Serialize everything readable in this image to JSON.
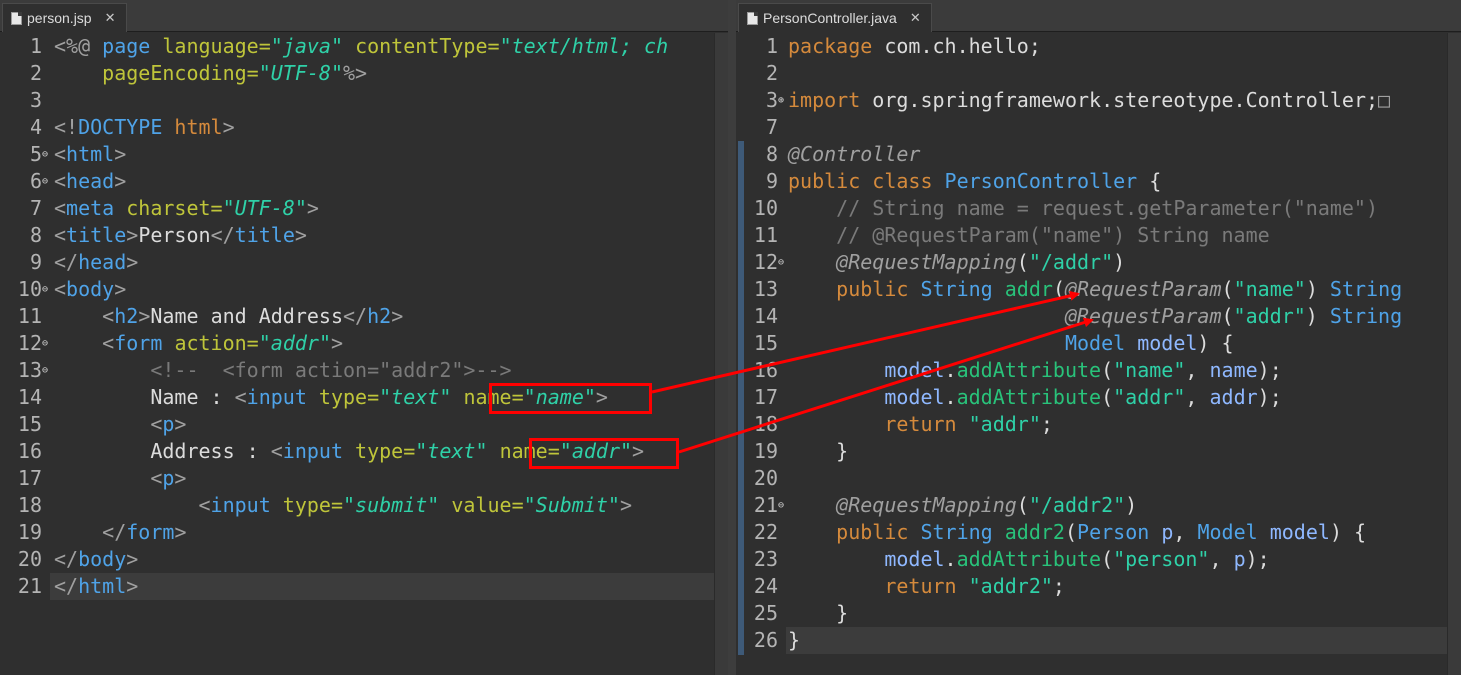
{
  "left_editor": {
    "tab_label": "person.jsp",
    "lines": [
      {
        "n": "1",
        "fold": "",
        "segs": [
          [
            "br",
            "<%@ "
          ],
          [
            "tg",
            "page "
          ],
          [
            "at",
            "language="
          ],
          [
            "av",
            "\"java\" "
          ],
          [
            "at",
            "contentType="
          ],
          [
            "av",
            "\"text/html; ch"
          ]
        ]
      },
      {
        "n": "2",
        "fold": "",
        "segs": [
          [
            "tx",
            "    "
          ],
          [
            "at",
            "pageEncoding="
          ],
          [
            "av",
            "\"UTF-8\""
          ],
          [
            "br",
            "%>"
          ]
        ]
      },
      {
        "n": "3",
        "fold": "",
        "segs": []
      },
      {
        "n": "4",
        "fold": "",
        "segs": [
          [
            "br",
            "<!"
          ],
          [
            "tg",
            "DOCTYPE "
          ],
          [
            "kw",
            "html"
          ],
          [
            "br",
            ">"
          ]
        ]
      },
      {
        "n": "5",
        "fold": "⊖",
        "segs": [
          [
            "br",
            "<"
          ],
          [
            "tg",
            "html"
          ],
          [
            "br",
            ">"
          ]
        ]
      },
      {
        "n": "6",
        "fold": "⊖",
        "segs": [
          [
            "br",
            "<"
          ],
          [
            "tg",
            "head"
          ],
          [
            "br",
            ">"
          ]
        ]
      },
      {
        "n": "7",
        "fold": "",
        "segs": [
          [
            "br",
            "<"
          ],
          [
            "tg",
            "meta "
          ],
          [
            "at",
            "charset="
          ],
          [
            "av",
            "\"UTF-8\""
          ],
          [
            "br",
            ">"
          ]
        ]
      },
      {
        "n": "8",
        "fold": "",
        "segs": [
          [
            "br",
            "<"
          ],
          [
            "tg",
            "title"
          ],
          [
            "br",
            ">"
          ],
          [
            "tx",
            "Person"
          ],
          [
            "br",
            "</"
          ],
          [
            "tg",
            "title"
          ],
          [
            "br",
            ">"
          ]
        ]
      },
      {
        "n": "9",
        "fold": "",
        "segs": [
          [
            "br",
            "</"
          ],
          [
            "tg",
            "head"
          ],
          [
            "br",
            ">"
          ]
        ]
      },
      {
        "n": "10",
        "fold": "⊖",
        "segs": [
          [
            "br",
            "<"
          ],
          [
            "tg",
            "body"
          ],
          [
            "br",
            ">"
          ]
        ]
      },
      {
        "n": "11",
        "fold": "",
        "segs": [
          [
            "tx",
            "    "
          ],
          [
            "br",
            "<"
          ],
          [
            "tg",
            "h2"
          ],
          [
            "br",
            ">"
          ],
          [
            "tx",
            "Name and Address"
          ],
          [
            "br",
            "</"
          ],
          [
            "tg",
            "h2"
          ],
          [
            "br",
            ">"
          ]
        ]
      },
      {
        "n": "12",
        "fold": "⊖",
        "segs": [
          [
            "tx",
            "    "
          ],
          [
            "br",
            "<"
          ],
          [
            "tg",
            "form "
          ],
          [
            "at",
            "action="
          ],
          [
            "av",
            "\"addr\""
          ],
          [
            "br",
            ">"
          ]
        ]
      },
      {
        "n": "13",
        "fold": "⊖",
        "segs": [
          [
            "tx",
            "        "
          ],
          [
            "cm",
            "<!--  <form action=\"addr2\">-->"
          ]
        ]
      },
      {
        "n": "14",
        "fold": "",
        "segs": [
          [
            "tx",
            "        Name : "
          ],
          [
            "br",
            "<"
          ],
          [
            "tg",
            "input "
          ],
          [
            "at",
            "type="
          ],
          [
            "av",
            "\"text\" "
          ],
          [
            "at",
            "name="
          ],
          [
            "av",
            "\"name\""
          ],
          [
            "br",
            ">"
          ]
        ]
      },
      {
        "n": "15",
        "fold": "",
        "segs": [
          [
            "tx",
            "        "
          ],
          [
            "br",
            "<"
          ],
          [
            "tg",
            "p"
          ],
          [
            "br",
            ">"
          ]
        ]
      },
      {
        "n": "16",
        "fold": "",
        "segs": [
          [
            "tx",
            "        Address : "
          ],
          [
            "br",
            "<"
          ],
          [
            "tg",
            "input "
          ],
          [
            "at",
            "type="
          ],
          [
            "av",
            "\"text\" "
          ],
          [
            "at",
            "name="
          ],
          [
            "av",
            "\"addr\""
          ],
          [
            "br",
            ">"
          ]
        ]
      },
      {
        "n": "17",
        "fold": "",
        "segs": [
          [
            "tx",
            "        "
          ],
          [
            "br",
            "<"
          ],
          [
            "tg",
            "p"
          ],
          [
            "br",
            ">"
          ]
        ]
      },
      {
        "n": "18",
        "fold": "",
        "segs": [
          [
            "tx",
            "            "
          ],
          [
            "br",
            "<"
          ],
          [
            "tg",
            "input "
          ],
          [
            "at",
            "type="
          ],
          [
            "av",
            "\"submit\" "
          ],
          [
            "at",
            "value="
          ],
          [
            "av",
            "\"Submit\""
          ],
          [
            "br",
            ">"
          ]
        ]
      },
      {
        "n": "19",
        "fold": "",
        "segs": [
          [
            "tx",
            "    "
          ],
          [
            "br",
            "</"
          ],
          [
            "tg",
            "form"
          ],
          [
            "br",
            ">"
          ]
        ]
      },
      {
        "n": "20",
        "fold": "",
        "segs": [
          [
            "br",
            "</"
          ],
          [
            "tg",
            "body"
          ],
          [
            "br",
            ">"
          ]
        ]
      },
      {
        "n": "21",
        "fold": "",
        "segs": [
          [
            "br",
            "</"
          ],
          [
            "tg",
            "html"
          ],
          [
            "br",
            ">"
          ]
        ]
      }
    ]
  },
  "right_editor": {
    "tab_label": "PersonController.java",
    "lines": [
      {
        "n": "1",
        "fold": "",
        "segs": [
          [
            "kw",
            "package "
          ],
          [
            "tx",
            "com.ch.hello;"
          ]
        ]
      },
      {
        "n": "2",
        "fold": "",
        "segs": []
      },
      {
        "n": "3",
        "fold": "⊕",
        "segs": [
          [
            "kw",
            "import "
          ],
          [
            "tx",
            "org.springframework.stereotype.Controller;"
          ],
          [
            "br",
            "□"
          ]
        ]
      },
      {
        "n": "7",
        "fold": "",
        "segs": []
      },
      {
        "n": "8",
        "fold": "",
        "segs": [
          [
            "an",
            "@Controller"
          ]
        ]
      },
      {
        "n": "9",
        "fold": "",
        "segs": [
          [
            "kw",
            "public class "
          ],
          [
            "ty",
            "PersonController "
          ],
          [
            "tx",
            "{"
          ]
        ]
      },
      {
        "n": "10",
        "fold": "",
        "segs": [
          [
            "tx",
            "    "
          ],
          [
            "cm",
            "// String name = request.getParameter(\"name\")"
          ]
        ]
      },
      {
        "n": "11",
        "fold": "",
        "segs": [
          [
            "tx",
            "    "
          ],
          [
            "cm",
            "// @RequestParam(\"name\") String name"
          ]
        ]
      },
      {
        "n": "12",
        "fold": "⊖",
        "segs": [
          [
            "tx",
            "    "
          ],
          [
            "an",
            "@RequestMapping"
          ],
          [
            "tx",
            "("
          ],
          [
            "st",
            "\"/addr\""
          ],
          [
            "tx",
            ")"
          ]
        ]
      },
      {
        "n": "13",
        "fold": "",
        "segs": [
          [
            "tx",
            "    "
          ],
          [
            "kw",
            "public "
          ],
          [
            "ty",
            "String "
          ],
          [
            "fn",
            "addr"
          ],
          [
            "tx",
            "("
          ],
          [
            "an",
            "@RequestParam"
          ],
          [
            "tx",
            "("
          ],
          [
            "st",
            "\"name\""
          ],
          [
            "tx",
            ") "
          ],
          [
            "ty",
            "String"
          ]
        ]
      },
      {
        "n": "14",
        "fold": "",
        "segs": [
          [
            "tx",
            "                       "
          ],
          [
            "an",
            "@RequestParam"
          ],
          [
            "tx",
            "("
          ],
          [
            "st",
            "\"addr\""
          ],
          [
            "tx",
            ") "
          ],
          [
            "ty",
            "String"
          ]
        ]
      },
      {
        "n": "15",
        "fold": "",
        "segs": [
          [
            "tx",
            "                       "
          ],
          [
            "ty",
            "Model "
          ],
          [
            "vr",
            "model"
          ],
          [
            "tx",
            ") {"
          ]
        ]
      },
      {
        "n": "16",
        "fold": "",
        "segs": [
          [
            "tx",
            "        "
          ],
          [
            "vr",
            "model"
          ],
          [
            "tx",
            "."
          ],
          [
            "fn",
            "addAttribute"
          ],
          [
            "tx",
            "("
          ],
          [
            "st",
            "\"name\""
          ],
          [
            "tx",
            ", "
          ],
          [
            "vr",
            "name"
          ],
          [
            "tx",
            ");"
          ]
        ]
      },
      {
        "n": "17",
        "fold": "",
        "segs": [
          [
            "tx",
            "        "
          ],
          [
            "vr",
            "model"
          ],
          [
            "tx",
            "."
          ],
          [
            "fn",
            "addAttribute"
          ],
          [
            "tx",
            "("
          ],
          [
            "st",
            "\"addr\""
          ],
          [
            "tx",
            ", "
          ],
          [
            "vr",
            "addr"
          ],
          [
            "tx",
            ");"
          ]
        ]
      },
      {
        "n": "18",
        "fold": "",
        "segs": [
          [
            "tx",
            "        "
          ],
          [
            "kw",
            "return "
          ],
          [
            "st",
            "\"addr\""
          ],
          [
            "tx",
            ";"
          ]
        ]
      },
      {
        "n": "19",
        "fold": "",
        "segs": [
          [
            "tx",
            "    }"
          ]
        ]
      },
      {
        "n": "20",
        "fold": "",
        "segs": []
      },
      {
        "n": "21",
        "fold": "⊖",
        "segs": [
          [
            "tx",
            "    "
          ],
          [
            "an",
            "@RequestMapping"
          ],
          [
            "tx",
            "("
          ],
          [
            "st",
            "\"/addr2\""
          ],
          [
            "tx",
            ")"
          ]
        ]
      },
      {
        "n": "22",
        "fold": "",
        "segs": [
          [
            "tx",
            "    "
          ],
          [
            "kw",
            "public "
          ],
          [
            "ty",
            "String "
          ],
          [
            "fn",
            "addr2"
          ],
          [
            "tx",
            "("
          ],
          [
            "ty",
            "Person "
          ],
          [
            "vr",
            "p"
          ],
          [
            "tx",
            ", "
          ],
          [
            "ty",
            "Model "
          ],
          [
            "vr",
            "model"
          ],
          [
            "tx",
            ") {"
          ]
        ]
      },
      {
        "n": "23",
        "fold": "",
        "segs": [
          [
            "tx",
            "        "
          ],
          [
            "vr",
            "model"
          ],
          [
            "tx",
            "."
          ],
          [
            "fn",
            "addAttribute"
          ],
          [
            "tx",
            "("
          ],
          [
            "st",
            "\"person\""
          ],
          [
            "tx",
            ", "
          ],
          [
            "vr",
            "p"
          ],
          [
            "tx",
            ");"
          ]
        ]
      },
      {
        "n": "24",
        "fold": "",
        "segs": [
          [
            "tx",
            "        "
          ],
          [
            "kw",
            "return "
          ],
          [
            "st",
            "\"addr2\""
          ],
          [
            "tx",
            ";"
          ]
        ]
      },
      {
        "n": "25",
        "fold": "",
        "segs": [
          [
            "tx",
            "    }"
          ]
        ]
      },
      {
        "n": "26",
        "fold": "",
        "segs": [
          [
            "tx",
            "}"
          ]
        ]
      }
    ]
  },
  "colors": {
    "annotation_box": "#ff0000",
    "arrow": "#ff0000",
    "editor_bg": "#2f2f2f"
  },
  "icons": {
    "tab_file_icon": "file-icon",
    "tab_close_icon": "close-icon"
  }
}
